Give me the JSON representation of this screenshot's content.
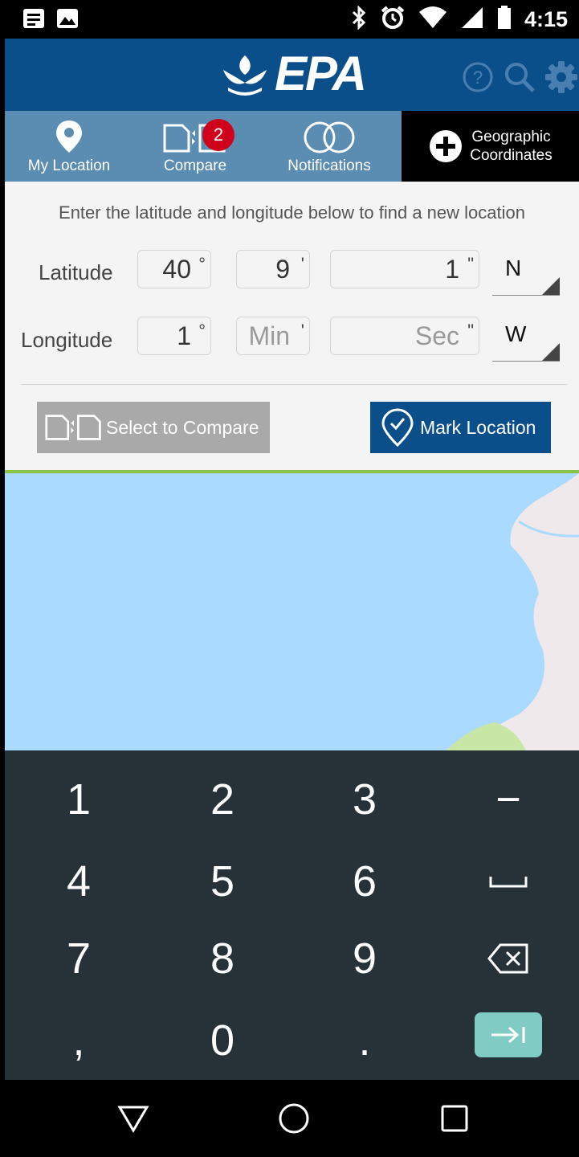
{
  "status_bar": {
    "time": "4:15",
    "left_icons": [
      "notes-icon",
      "image-icon"
    ],
    "right_icons": [
      "bluetooth-icon",
      "alarm-icon",
      "wifi-icon",
      "signal-icon",
      "battery-icon"
    ]
  },
  "header": {
    "logo_text": "EPA",
    "actions": [
      "help-icon",
      "search-icon",
      "settings-icon"
    ]
  },
  "tabs": [
    {
      "label": "My Location",
      "icon": "location-pin-icon"
    },
    {
      "label": "Compare",
      "icon": "compare-icon",
      "badge": "2"
    },
    {
      "label": "Notifications",
      "icon": "notifications-rings-icon"
    },
    {
      "label_line1": "Geographic",
      "label_line2": "Coordinates",
      "icon": "plus-circle-icon",
      "active": true
    }
  ],
  "form": {
    "instructions": "Enter the latitude and longitude below to find a new location",
    "latitude": {
      "label": "Latitude",
      "degrees": "40",
      "minutes": "9",
      "seconds": "1",
      "direction": "N"
    },
    "longitude": {
      "label": "Longitude",
      "degrees": "1",
      "minutes_placeholder": "Min",
      "seconds_placeholder": "Sec",
      "direction": "W"
    },
    "units": {
      "degree": "°",
      "minute": "'",
      "second": "\""
    },
    "compare_button": "Select to Compare",
    "mark_button": "Mark Location"
  },
  "keyboard": {
    "rows": [
      [
        "1",
        "2",
        "3",
        "−"
      ],
      [
        "4",
        "5",
        "6",
        "␣"
      ],
      [
        "7",
        "8",
        "9",
        "⌫"
      ],
      [
        ",",
        "0",
        ".",
        "→|"
      ]
    ]
  },
  "colors": {
    "header_blue": "#0b4f8a",
    "tab_blue": "#5b8db3",
    "badge_red": "#d0021b",
    "map_water": "#aadaff",
    "map_land": "#efe9ec",
    "keyboard_bg": "#263238",
    "done_key": "#80cbc4"
  }
}
